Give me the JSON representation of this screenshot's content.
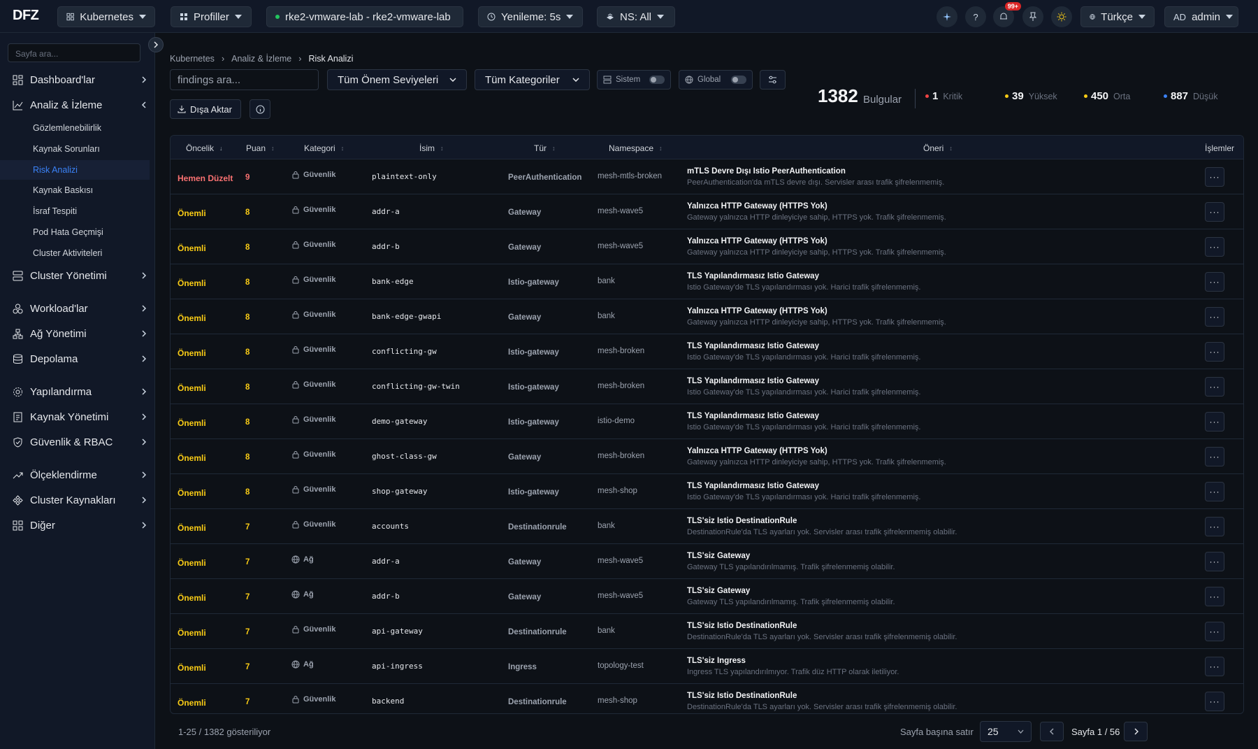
{
  "header": {
    "logo": "DFZ",
    "kubernetes": "Kubernetes",
    "profiles": "Profiller",
    "cluster": "rke2-vmware-lab - rke2-vmware-lab",
    "refresh": "Yenileme: 5s",
    "namespace": "NS: All",
    "notifications_badge": "99+",
    "language": "Türkçe",
    "user_initials": "AD",
    "user_name": "admin"
  },
  "sidebar": {
    "search_placeholder": "Sayfa ara...",
    "items": [
      {
        "label": "Dashboard'lar",
        "icon": "dashboard-icon"
      },
      {
        "label": "Analiz & İzleme",
        "icon": "chart-line-icon"
      },
      {
        "label": "Cluster Yönetimi",
        "icon": "server-icon"
      },
      {
        "label": "Workload'lar",
        "icon": "workloads-icon"
      },
      {
        "label": "Ağ Yönetimi",
        "icon": "network-icon"
      },
      {
        "label": "Depolama",
        "icon": "database-icon"
      },
      {
        "label": "Yapılandırma",
        "icon": "gear-icon"
      },
      {
        "label": "Kaynak Yönetimi",
        "icon": "resource-icon"
      },
      {
        "label": "Güvenlik & RBAC",
        "icon": "shield-icon"
      },
      {
        "label": "Ölçeklendirme",
        "icon": "trend-up-icon"
      },
      {
        "label": "Cluster Kaynakları",
        "icon": "cluster-resources-icon"
      },
      {
        "label": "Diğer",
        "icon": "grid-icon"
      }
    ],
    "subitems": [
      "Gözlemlenebilirlik",
      "Kaynak Sorunları",
      "Risk Analizi",
      "Kaynak Baskısı",
      "İsraf Tespiti",
      "Pod Hata Geçmişi",
      "Cluster Aktiviteleri"
    ]
  },
  "breadcrumb": [
    "Kubernetes",
    "Analiz & İzleme",
    "Risk Analizi"
  ],
  "filters": {
    "search_placeholder": "findings ara...",
    "severity": "Tüm Önem Seviyeleri",
    "category": "Tüm Kategoriler",
    "system_toggle": "Sistem",
    "global_toggle": "Global",
    "export": "Dışa Aktar"
  },
  "stats": {
    "total": "1382",
    "total_label": "Bulgular",
    "critical": "1",
    "critical_label": "Kritik",
    "high": "39",
    "high_label": "Yüksek",
    "medium": "450",
    "medium_label": "Orta",
    "low": "887",
    "low_label": "Düşük",
    "colors": {
      "critical": "#ef4444",
      "high": "#facc15",
      "medium": "#facc15",
      "low": "#3b82f6"
    }
  },
  "table": {
    "columns": [
      "Öncelik",
      "Puan",
      "Kategori",
      "İsim",
      "Tür",
      "Namespace",
      "Öneri",
      "İşlemler"
    ],
    "rows": [
      {
        "priority": "Hemen Düzelt",
        "score": "9",
        "category": "Güvenlik",
        "name": "plaintext-only",
        "kind": "PeerAuthentication",
        "namespace": "mesh-mtls-broken",
        "rec_title": "mTLS Devre Dışı Istio PeerAuthentication",
        "rec_desc": "PeerAuthentication'da mTLS devre dışı. Servisler arası trafik şifrelenmemiş."
      },
      {
        "priority": "Önemli",
        "score": "8",
        "category": "Güvenlik",
        "name": "addr-a",
        "kind": "Gateway",
        "namespace": "mesh-wave5",
        "rec_title": "Yalnızca HTTP Gateway (HTTPS Yok)",
        "rec_desc": "Gateway yalnızca HTTP dinleyiciye sahip, HTTPS yok. Trafik şifrelenmemiş."
      },
      {
        "priority": "Önemli",
        "score": "8",
        "category": "Güvenlik",
        "name": "addr-b",
        "kind": "Gateway",
        "namespace": "mesh-wave5",
        "rec_title": "Yalnızca HTTP Gateway (HTTPS Yok)",
        "rec_desc": "Gateway yalnızca HTTP dinleyiciye sahip, HTTPS yok. Trafik şifrelenmemiş."
      },
      {
        "priority": "Önemli",
        "score": "8",
        "category": "Güvenlik",
        "name": "bank-edge",
        "kind": "Istio-gateway",
        "namespace": "bank",
        "rec_title": "TLS Yapılandırmasız Istio Gateway",
        "rec_desc": "Istio Gateway'de TLS yapılandırması yok. Harici trafik şifrelenmemiş."
      },
      {
        "priority": "Önemli",
        "score": "8",
        "category": "Güvenlik",
        "name": "bank-edge-gwapi",
        "kind": "Gateway",
        "namespace": "bank",
        "rec_title": "Yalnızca HTTP Gateway (HTTPS Yok)",
        "rec_desc": "Gateway yalnızca HTTP dinleyiciye sahip, HTTPS yok. Trafik şifrelenmemiş."
      },
      {
        "priority": "Önemli",
        "score": "8",
        "category": "Güvenlik",
        "name": "conflicting-gw",
        "kind": "Istio-gateway",
        "namespace": "mesh-broken",
        "rec_title": "TLS Yapılandırmasız Istio Gateway",
        "rec_desc": "Istio Gateway'de TLS yapılandırması yok. Harici trafik şifrelenmemiş."
      },
      {
        "priority": "Önemli",
        "score": "8",
        "category": "Güvenlik",
        "name": "conflicting-gw-twin",
        "kind": "Istio-gateway",
        "namespace": "mesh-broken",
        "rec_title": "TLS Yapılandırmasız Istio Gateway",
        "rec_desc": "Istio Gateway'de TLS yapılandırması yok. Harici trafik şifrelenmemiş."
      },
      {
        "priority": "Önemli",
        "score": "8",
        "category": "Güvenlik",
        "name": "demo-gateway",
        "kind": "Istio-gateway",
        "namespace": "istio-demo",
        "rec_title": "TLS Yapılandırmasız Istio Gateway",
        "rec_desc": "Istio Gateway'de TLS yapılandırması yok. Harici trafik şifrelenmemiş."
      },
      {
        "priority": "Önemli",
        "score": "8",
        "category": "Güvenlik",
        "name": "ghost-class-gw",
        "kind": "Gateway",
        "namespace": "mesh-broken",
        "rec_title": "Yalnızca HTTP Gateway (HTTPS Yok)",
        "rec_desc": "Gateway yalnızca HTTP dinleyiciye sahip, HTTPS yok. Trafik şifrelenmemiş."
      },
      {
        "priority": "Önemli",
        "score": "8",
        "category": "Güvenlik",
        "name": "shop-gateway",
        "kind": "Istio-gateway",
        "namespace": "mesh-shop",
        "rec_title": "TLS Yapılandırmasız Istio Gateway",
        "rec_desc": "Istio Gateway'de TLS yapılandırması yok. Harici trafik şifrelenmemiş."
      },
      {
        "priority": "Önemli",
        "score": "7",
        "category": "Güvenlik",
        "name": "accounts",
        "kind": "Destinationrule",
        "namespace": "bank",
        "rec_title": "TLS'siz Istio DestinationRule",
        "rec_desc": "DestinationRule'da TLS ayarları yok. Servisler arası trafik şifrelenmemiş olabilir."
      },
      {
        "priority": "Önemli",
        "score": "7",
        "category": "Ağ",
        "name": "addr-a",
        "kind": "Gateway",
        "namespace": "mesh-wave5",
        "rec_title": "TLS'siz Gateway",
        "rec_desc": "Gateway TLS yapılandırılmamış. Trafik şifrelenmemiş olabilir."
      },
      {
        "priority": "Önemli",
        "score": "7",
        "category": "Ağ",
        "name": "addr-b",
        "kind": "Gateway",
        "namespace": "mesh-wave5",
        "rec_title": "TLS'siz Gateway",
        "rec_desc": "Gateway TLS yapılandırılmamış. Trafik şifrelenmemiş olabilir."
      },
      {
        "priority": "Önemli",
        "score": "7",
        "category": "Güvenlik",
        "name": "api-gateway",
        "kind": "Destinationrule",
        "namespace": "bank",
        "rec_title": "TLS'siz Istio DestinationRule",
        "rec_desc": "DestinationRule'da TLS ayarları yok. Servisler arası trafik şifrelenmemiş olabilir."
      },
      {
        "priority": "Önemli",
        "score": "7",
        "category": "Ağ",
        "name": "api-ingress",
        "kind": "Ingress",
        "namespace": "topology-test",
        "rec_title": "TLS'siz Ingress",
        "rec_desc": "Ingress TLS yapılandırılmıyor. Trafik düz HTTP olarak iletiliyor."
      },
      {
        "priority": "Önemli",
        "score": "7",
        "category": "Güvenlik",
        "name": "backend",
        "kind": "Destinationrule",
        "namespace": "mesh-shop",
        "rec_title": "TLS'siz Istio DestinationRule",
        "rec_desc": "DestinationRule'da TLS ayarları yok. Servisler arası trafik şifrelenmemiş olabilir."
      }
    ],
    "actions_glyph": "···"
  },
  "footer": {
    "showing": "1-25 / 1382 gösteriliyor",
    "rows_per_page_label": "Sayfa başına satır",
    "rows_per_page": "25",
    "page": "Sayfa 1 / 56"
  },
  "colors": {
    "accent": "#3b82f6",
    "urgent": "#f87171",
    "important": "#facc15"
  }
}
